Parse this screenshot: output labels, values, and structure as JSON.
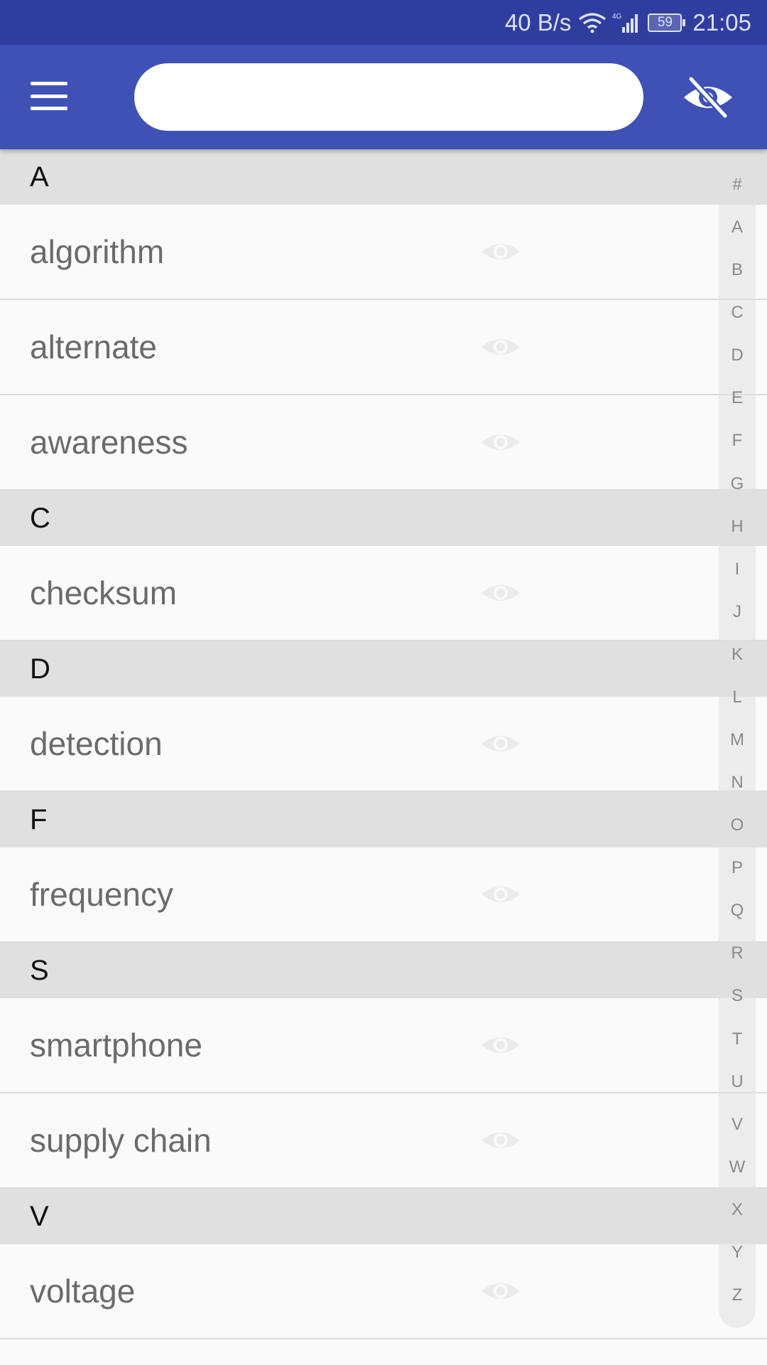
{
  "status_bar": {
    "speed": "40 B/s",
    "battery": "59",
    "time": "21:05",
    "icons": [
      "wifi-icon",
      "signal-4g-icon",
      "battery-icon"
    ]
  },
  "app_bar": {
    "menu_icon": "hamburger-menu-icon",
    "search": {
      "value": "",
      "placeholder": ""
    },
    "toggle_icon": "eye-off-icon",
    "color": "#3f51b5"
  },
  "sections": [
    {
      "letter": "A",
      "words": [
        "algorithm",
        "alternate",
        "awareness"
      ]
    },
    {
      "letter": "C",
      "words": [
        "checksum"
      ]
    },
    {
      "letter": "D",
      "words": [
        "detection"
      ]
    },
    {
      "letter": "F",
      "words": [
        "frequency"
      ]
    },
    {
      "letter": "S",
      "words": [
        "smartphone",
        "supply chain"
      ]
    },
    {
      "letter": "V",
      "words": [
        "voltage"
      ]
    }
  ],
  "index_letters": [
    "#",
    "A",
    "B",
    "C",
    "D",
    "E",
    "F",
    "G",
    "H",
    "I",
    "J",
    "K",
    "L",
    "M",
    "N",
    "O",
    "P",
    "Q",
    "R",
    "S",
    "T",
    "U",
    "V",
    "W",
    "X",
    "Y",
    "Z"
  ]
}
